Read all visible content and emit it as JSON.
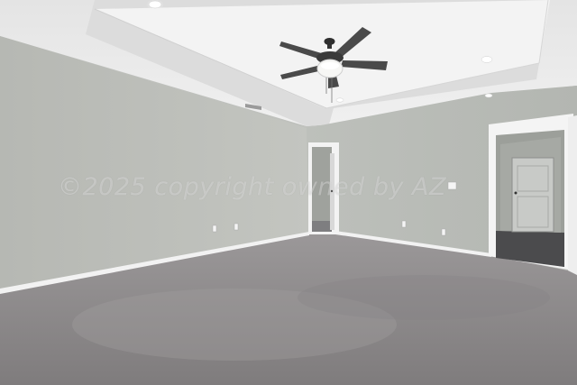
{
  "watermark": {
    "text": "©2025 copyright owned by AZ"
  },
  "colors": {
    "ceiling": "#eaeaea",
    "tray_ceiling": "#f1f1f1",
    "wall_left": "#bcbeb9",
    "wall_back": "#b7bab5",
    "carpet": "#8e8b8c",
    "trim": "#f4f4f4",
    "hall_floor": "#4b4b4d"
  },
  "icons": {
    "ceiling_fan": "ceiling-fan-icon",
    "recessed_light": "recessed-light-icon",
    "outlet": "outlet-icon",
    "light_switch": "light-switch-icon"
  }
}
